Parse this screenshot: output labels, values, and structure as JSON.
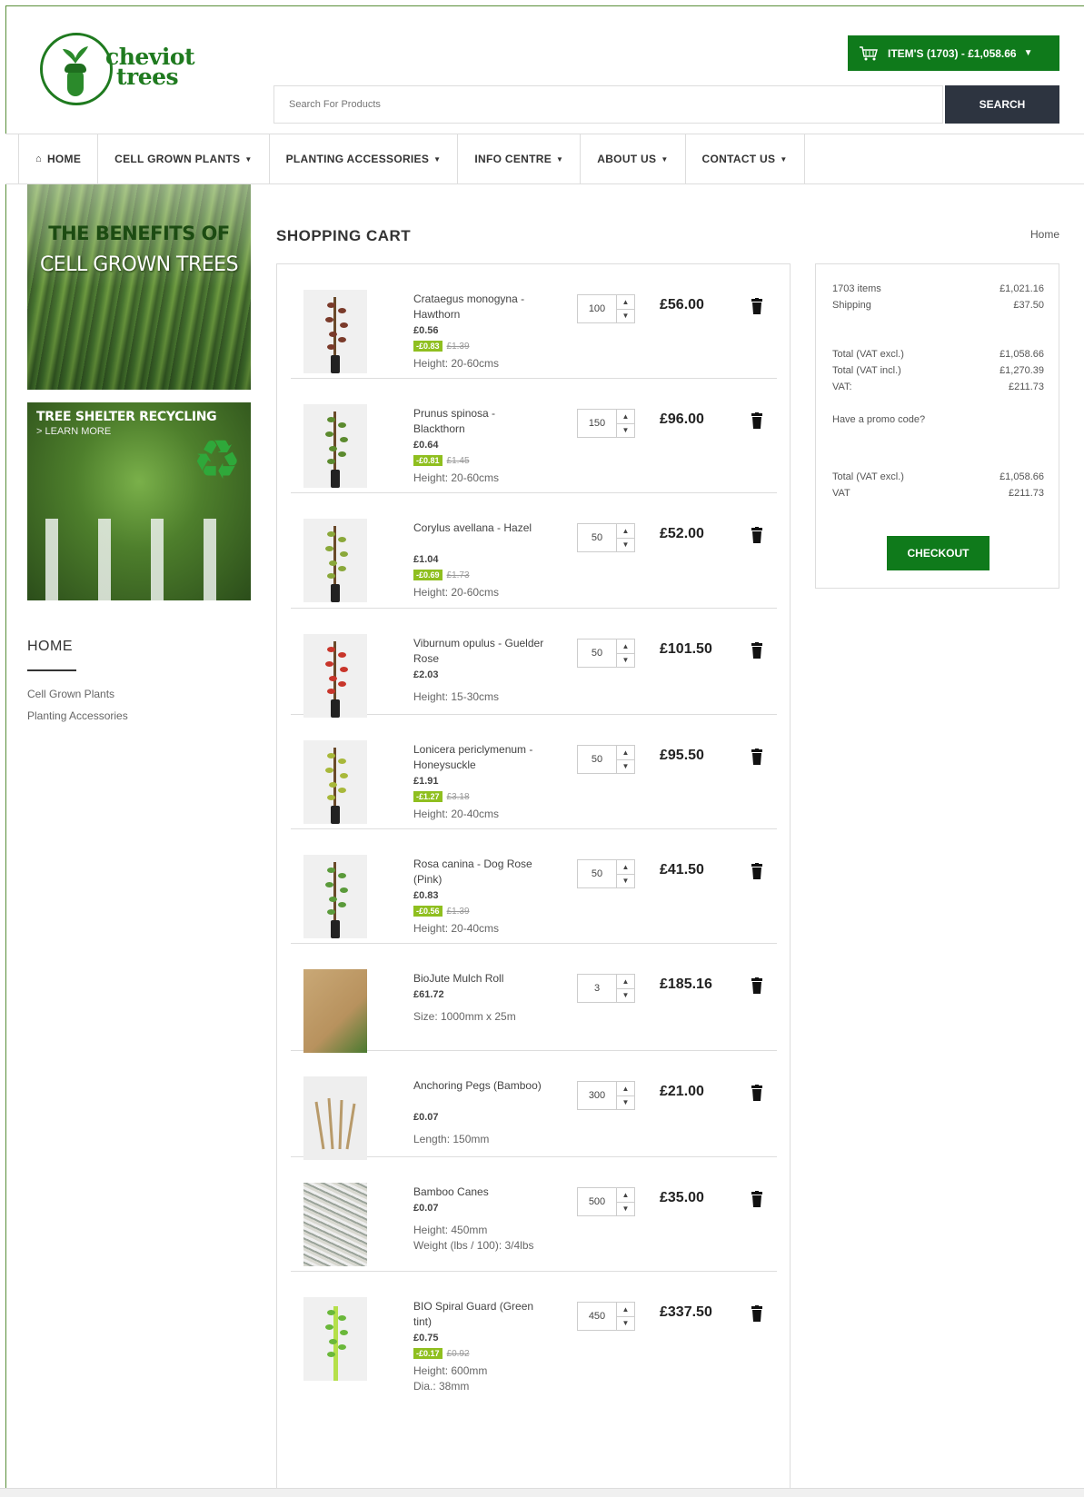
{
  "logo": {
    "text_line1": "cheviot",
    "text_line2": "trees"
  },
  "header": {
    "cart_label": "ITEM'S (1703) - £1,058.66",
    "search": {
      "placeholder": "Search For Products",
      "button": "SEARCH"
    }
  },
  "nav": [
    {
      "label": "HOME",
      "icon": "home-icon",
      "caret": false
    },
    {
      "label": "CELL GROWN PLANTS",
      "caret": true
    },
    {
      "label": "PLANTING ACCESSORIES",
      "caret": true
    },
    {
      "label": "INFO CENTRE",
      "caret": true
    },
    {
      "label": "ABOUT US",
      "caret": true
    },
    {
      "label": "CONTACT US",
      "caret": true
    }
  ],
  "sidebar": {
    "banner1": {
      "line1": "THE BENEFITS OF",
      "line2": "CELL GROWN TREES"
    },
    "banner2": {
      "line1": "TREE SHELTER RECYCLING",
      "line2": "> LEARN MORE"
    },
    "title": "HOME",
    "links": [
      "Cell Grown Plants",
      "Planting Accessories"
    ]
  },
  "page": {
    "title": "SHOPPING CART",
    "breadcrumb": "Home"
  },
  "cart_items": [
    {
      "name": "Crataegus monogyna - Hawthorn",
      "price": "£0.56",
      "discount": "-£0.83",
      "old_price": "£1.39",
      "attrs": [
        "Height: 20-60cms"
      ],
      "qty": "100",
      "total": "£56.00"
    },
    {
      "name": "Prunus spinosa - Blackthorn",
      "price": "£0.64",
      "discount": "-£0.81",
      "old_price": "£1.45",
      "attrs": [
        "Height: 20-60cms"
      ],
      "qty": "150",
      "total": "£96.00"
    },
    {
      "name": "Corylus avellana - Hazel",
      "price": "£1.04",
      "discount": "-£0.69",
      "old_price": "£1.73",
      "attrs": [
        "Height: 20-60cms"
      ],
      "qty": "50",
      "total": "£52.00"
    },
    {
      "name": "Viburnum opulus - Guelder Rose",
      "price": "£2.03",
      "discount": "",
      "old_price": "",
      "attrs": [
        "Height: 15-30cms"
      ],
      "qty": "50",
      "total": "£101.50"
    },
    {
      "name": "Lonicera periclymenum - Honeysuckle",
      "price": "£1.91",
      "discount": "-£1.27",
      "old_price": "£3.18",
      "attrs": [
        "Height: 20-40cms"
      ],
      "qty": "50",
      "total": "£95.50"
    },
    {
      "name": "Rosa canina - Dog Rose (Pink)",
      "price": "£0.83",
      "discount": "-£0.56",
      "old_price": "£1.39",
      "attrs": [
        "Height: 20-40cms"
      ],
      "qty": "50",
      "total": "£41.50"
    },
    {
      "name": "BioJute Mulch Roll",
      "price": "£61.72",
      "discount": "",
      "old_price": "",
      "attrs": [
        "Size: 1000mm x 25m"
      ],
      "qty": "3",
      "total": "£185.16"
    },
    {
      "name": "Anchoring Pegs (Bamboo)",
      "price": "£0.07",
      "discount": "",
      "old_price": "",
      "attrs": [
        "Length: 150mm"
      ],
      "qty": "300",
      "total": "£21.00"
    },
    {
      "name": "Bamboo Canes",
      "price": "£0.07",
      "discount": "",
      "old_price": "",
      "attrs": [
        "Height: 450mm",
        "Weight (lbs / 100): 3/4lbs"
      ],
      "qty": "500",
      "total": "£35.00"
    },
    {
      "name": "BIO Spiral Guard (Green tint)",
      "price": "£0.75",
      "discount": "-£0.17",
      "old_price": "£0.92",
      "attrs": [
        "Height: 600mm",
        "Dia.: 38mm"
      ],
      "qty": "450",
      "total": "£337.50"
    }
  ],
  "summary": {
    "items_label": "1703 items",
    "items_value": "£1,021.16",
    "shipping_label": "Shipping",
    "shipping_value": "£37.50",
    "total_excl_label": "Total (VAT excl.)",
    "total_excl_value": "£1,058.66",
    "total_incl_label": "Total (VAT incl.)",
    "total_incl_value": "£1,270.39",
    "vat_label": "VAT:",
    "vat_value": "£211.73",
    "promo": "Have a promo code?",
    "total_excl2_label": "Total (VAT excl.)",
    "total_excl2_value": "£1,058.66",
    "vat2_label": "VAT",
    "vat2_value": "£211.73",
    "checkout": "CHECKOUT"
  },
  "colors": {
    "brand_green": "#0f7a1b",
    "search_button": "#2d3440",
    "discount_badge": "#8fbf1f"
  }
}
